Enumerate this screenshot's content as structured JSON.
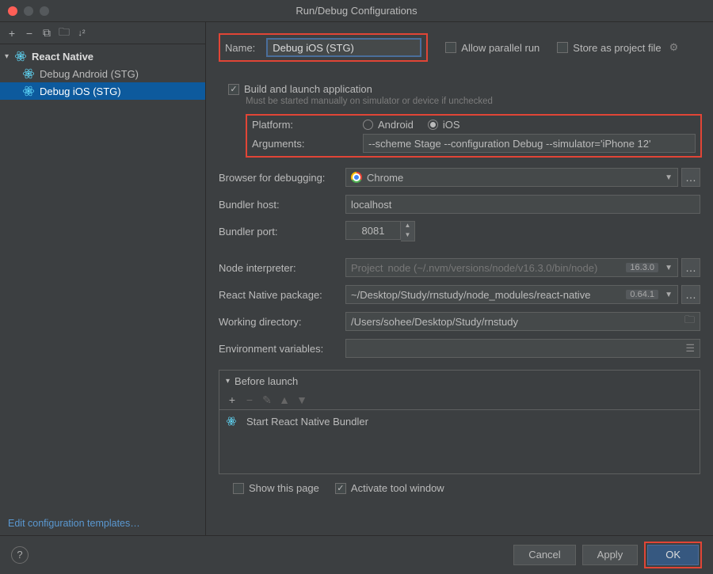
{
  "window": {
    "title": "Run/Debug Configurations"
  },
  "sidebar": {
    "parent": "React Native",
    "children": [
      {
        "label": "Debug Android (STG)"
      },
      {
        "label": "Debug iOS (STG)"
      }
    ],
    "editTemplates": "Edit configuration templates…"
  },
  "form": {
    "nameLabel": "Name:",
    "nameValue": "Debug iOS (STG)",
    "allowParallel": "Allow parallel run",
    "storeProject": "Store as project file",
    "buildLaunch": "Build and launch application",
    "buildNote": "Must be started manually on simulator or device if unchecked",
    "platformLabel": "Platform:",
    "platformAndroid": "Android",
    "platformIos": "iOS",
    "argsLabel": "Arguments:",
    "argsValue": "--scheme Stage --configuration Debug --simulator='iPhone 12'",
    "browserLabel": "Browser for debugging:",
    "browserValue": "Chrome",
    "bundlerHostLabel": "Bundler host:",
    "bundlerHostValue": "localhost",
    "bundlerPortLabel": "Bundler port:",
    "bundlerPortValue": "8081",
    "nodeLabel": "Node interpreter:",
    "nodePrefix": "Project",
    "nodePath": "node (~/.nvm/versions/node/v16.3.0/bin/node)",
    "nodeVer": "16.3.0",
    "rnPkgLabel": "React Native package:",
    "rnPkgValue": "~/Desktop/Study/rnstudy/node_modules/react-native",
    "rnPkgVer": "0.64.1",
    "workDirLabel": "Working directory:",
    "workDirValue": "/Users/sohee/Desktop/Study/rnstudy",
    "envLabel": "Environment variables:",
    "envValue": ""
  },
  "before": {
    "title": "Before launch",
    "task": "Start React Native Bundler"
  },
  "bottom": {
    "showPage": "Show this page",
    "activate": "Activate tool window"
  },
  "buttons": {
    "cancel": "Cancel",
    "apply": "Apply",
    "ok": "OK"
  }
}
